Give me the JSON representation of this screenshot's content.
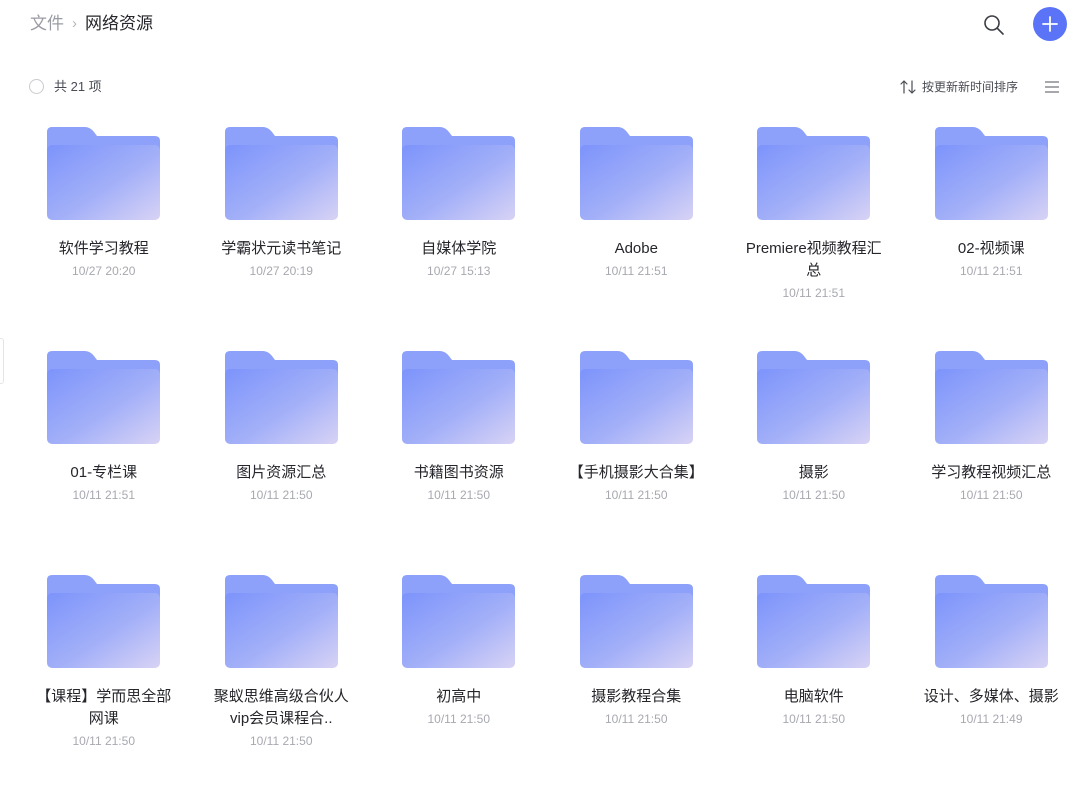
{
  "breadcrumb": {
    "root": "文件",
    "separator": "›",
    "current": "网络资源"
  },
  "toolbar": {
    "count_label": "共 21 项",
    "sort_label": "按更新新时间排序"
  },
  "colors": {
    "accent": "#5b73f6",
    "folder_top": "#8da1fb",
    "folder_front_start": "#7c93fb",
    "folder_front_end": "#d8d3f5"
  },
  "folders": [
    {
      "name": "软件学习教程",
      "date": "10/27 20:20"
    },
    {
      "name": "学霸状元读书笔记",
      "date": "10/27 20:19"
    },
    {
      "name": "自媒体学院",
      "date": "10/27 15:13"
    },
    {
      "name": "Adobe",
      "date": "10/11 21:51"
    },
    {
      "name": "Premiere视频教程汇总",
      "date": "10/11 21:51"
    },
    {
      "name": "02-视频课",
      "date": "10/11 21:51"
    },
    {
      "name": "01-专栏课",
      "date": "10/11 21:51"
    },
    {
      "name": "图片资源汇总",
      "date": "10/11 21:50"
    },
    {
      "name": "书籍图书资源",
      "date": "10/11 21:50"
    },
    {
      "name": "【手机摄影大合集】",
      "date": "10/11 21:50"
    },
    {
      "name": "摄影",
      "date": "10/11 21:50"
    },
    {
      "name": "学习教程视频汇总",
      "date": "10/11 21:50"
    },
    {
      "name": "【课程】学而思全部网课",
      "date": "10/11 21:50"
    },
    {
      "name": "聚蚁思维高级合伙人vip会员课程合..",
      "date": "10/11 21:50"
    },
    {
      "name": "初高中",
      "date": "10/11 21:50"
    },
    {
      "name": "摄影教程合集",
      "date": "10/11 21:50"
    },
    {
      "name": "电脑软件",
      "date": "10/11 21:50"
    },
    {
      "name": "设计、多媒体、摄影",
      "date": "10/11 21:49"
    }
  ]
}
